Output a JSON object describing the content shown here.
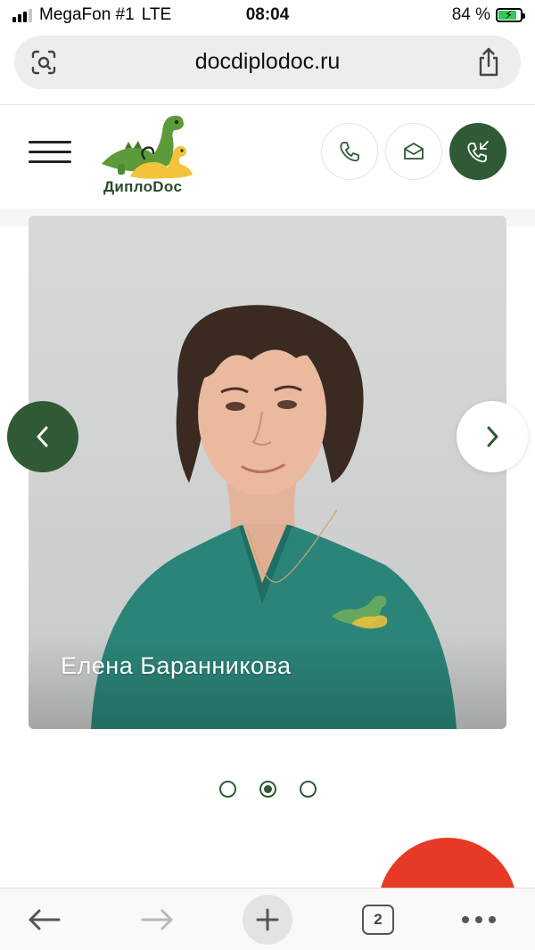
{
  "status_bar": {
    "carrier": "MegaFon #1",
    "network": "LTE",
    "time": "08:04",
    "battery": "84 %",
    "battery_level": 0.84
  },
  "browser": {
    "url": "docdiplodoc.ru",
    "open_tabs": "2"
  },
  "header": {
    "logo_text": "ДиплоDoc"
  },
  "slider": {
    "caption": "Елена Баранникова",
    "active_index": 1,
    "total": 3
  },
  "colors": {
    "brand_green": "#2f5a35",
    "fab_red": "#e63a26",
    "scrubs_teal": "#2a8578"
  },
  "icons": [
    "lens-icon",
    "share-icon",
    "hamburger-icon",
    "phone-icon",
    "mail-icon",
    "callback-icon",
    "chevron-left-icon",
    "chevron-right-icon",
    "back-arrow-icon",
    "forward-arrow-icon",
    "plus-icon",
    "more-icon"
  ]
}
